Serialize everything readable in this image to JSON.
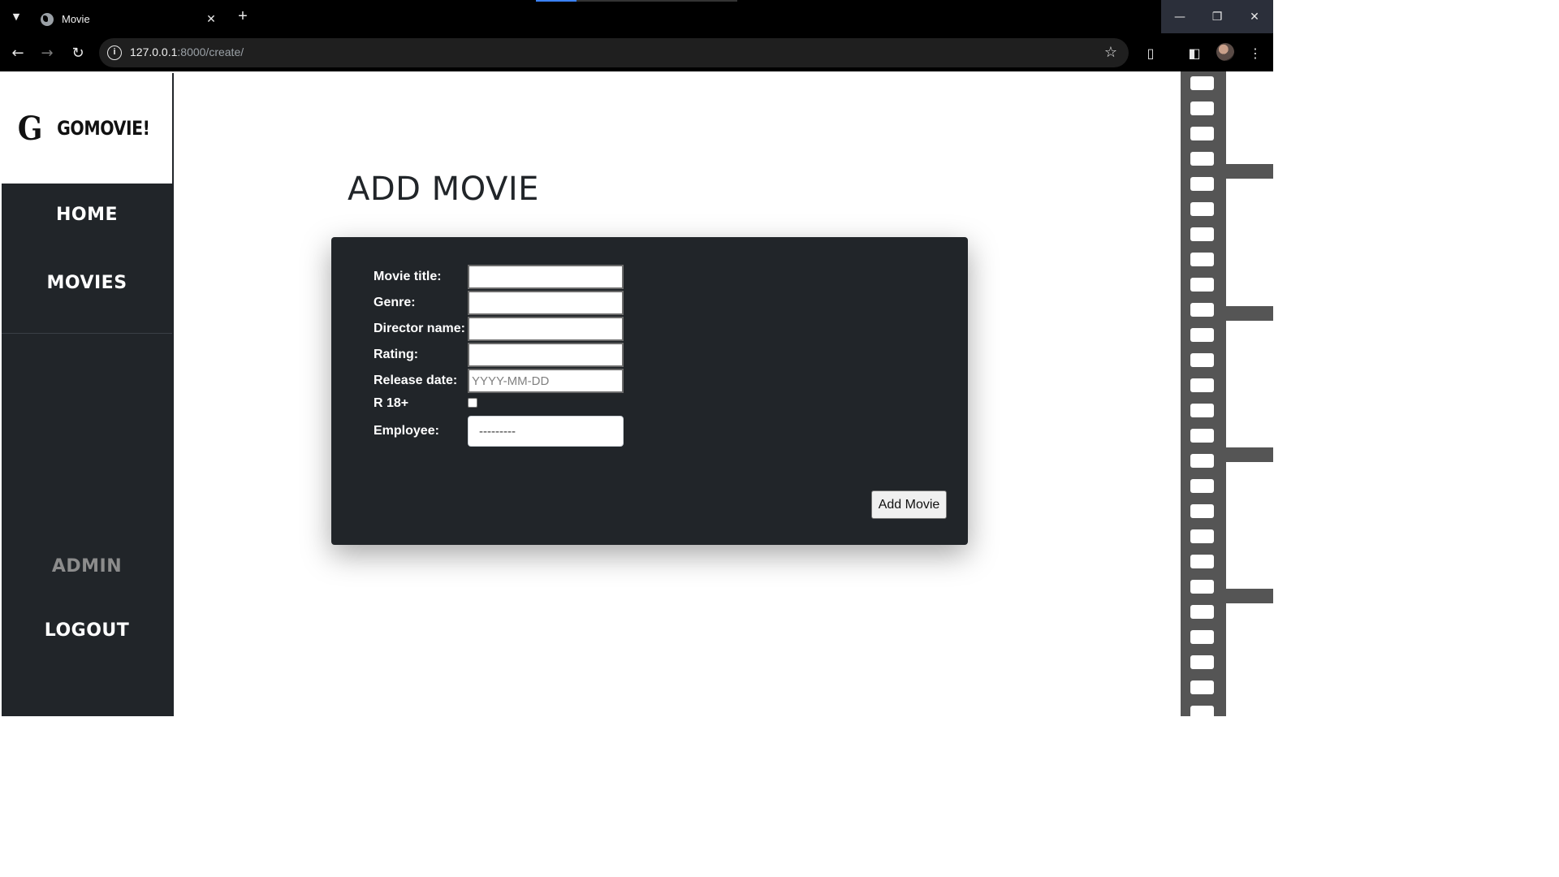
{
  "browser": {
    "tab_title": "Movie",
    "url_host": "127.0.0.1",
    "url_rest": ":8000/create/"
  },
  "sidebar": {
    "logo_letter": "G",
    "logo_text": "GOMOVIE!",
    "home": "HOME",
    "movies": "MOVIES",
    "admin": "ADMIN",
    "logout": "LOGOUT"
  },
  "main": {
    "heading": "ADD MOVIE",
    "form": {
      "title_label": "Movie title:",
      "genre_label": "Genre:",
      "director_label": "Director name:",
      "rating_label": "Rating:",
      "release_label": "Release date:",
      "release_placeholder": "YYYY-MM-DD",
      "r18_label": "R 18+",
      "employee_label": "Employee:",
      "employee_value": "---------",
      "submit_label": "Add Movie"
    }
  }
}
